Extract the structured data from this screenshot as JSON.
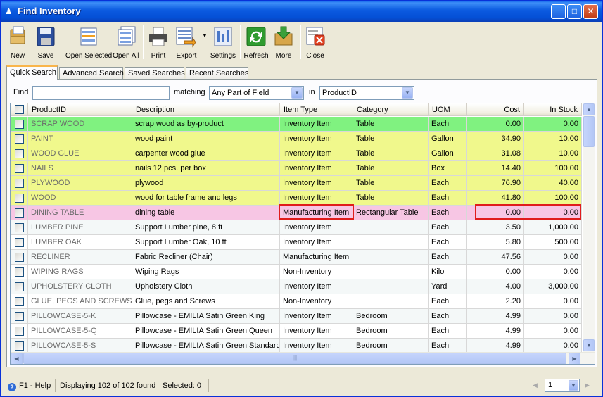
{
  "window": {
    "title": "Find Inventory",
    "controls": [
      "_",
      "□",
      "✕"
    ]
  },
  "toolbar": [
    {
      "label": "New",
      "icon": "new-icon"
    },
    {
      "label": "Save",
      "icon": "save-icon"
    },
    {
      "label": "Open Selected",
      "icon": "open-selected-icon"
    },
    {
      "label": "Open All",
      "icon": "open-all-icon"
    },
    {
      "label": "Print",
      "icon": "print-icon"
    },
    {
      "label": "Export",
      "icon": "export-icon"
    },
    {
      "label": "Settings",
      "icon": "settings-icon"
    },
    {
      "label": "Refresh",
      "icon": "refresh-icon"
    },
    {
      "label": "More",
      "icon": "more-icon"
    },
    {
      "label": "Close",
      "icon": "close-icon"
    }
  ],
  "tabs": [
    "Quick Search",
    "Advanced Search",
    "Saved Searches",
    "Recent Searches"
  ],
  "find": {
    "label": "Find",
    "value": "",
    "matching_label": "matching",
    "matching_value": "Any Part of Field",
    "in_label": "in",
    "in_value": "ProductID"
  },
  "columns": [
    "ProductID",
    "Description",
    "Item Type",
    "Category",
    "UOM",
    "Cost",
    "In Stock"
  ],
  "rows": [
    {
      "id": "SCRAP WOOD",
      "desc": "scrap wood as by-product",
      "type": "Inventory Item",
      "cat": "Table",
      "uom": "Each",
      "cost": "0.00",
      "stock": "0.00",
      "bg": "#80f280"
    },
    {
      "id": "PAINT",
      "desc": "wood paint",
      "type": "Inventory Item",
      "cat": "Table",
      "uom": "Gallon",
      "cost": "34.90",
      "stock": "10.00",
      "bg": "#f0f88c"
    },
    {
      "id": "WOOD GLUE",
      "desc": "carpenter wood glue",
      "type": "Inventory Item",
      "cat": "Table",
      "uom": "Gallon",
      "cost": "31.08",
      "stock": "10.00",
      "bg": "#f0f88c"
    },
    {
      "id": "NAILS",
      "desc": "nails 12 pcs. per box",
      "type": "Inventory Item",
      "cat": "Table",
      "uom": "Box",
      "cost": "14.40",
      "stock": "100.00",
      "bg": "#f0f88c"
    },
    {
      "id": "PLYWOOD",
      "desc": "plywood",
      "type": "Inventory Item",
      "cat": "Table",
      "uom": "Each",
      "cost": "76.90",
      "stock": "40.00",
      "bg": "#f0f88c"
    },
    {
      "id": "WOOD",
      "desc": "wood for table frame and legs",
      "type": "Inventory Item",
      "cat": "Table",
      "uom": "Each",
      "cost": "41.80",
      "stock": "100.00",
      "bg": "#f0f88c"
    },
    {
      "id": "DINING TABLE",
      "desc": "dining table",
      "type": "Manufacturing Item",
      "cat": "Rectangular Table",
      "uom": "Each",
      "cost": "0.00",
      "stock": "0.00",
      "bg": "#f7c6e4"
    },
    {
      "id": "LUMBER PINE",
      "desc": "Support Lumber pine, 8 ft",
      "type": "Inventory Item",
      "cat": "",
      "uom": "Each",
      "cost": "3.50",
      "stock": "1,000.00",
      "bg": "#f4f8f8"
    },
    {
      "id": "LUMBER OAK",
      "desc": "Support Lumber Oak, 10 ft",
      "type": "Inventory Item",
      "cat": "",
      "uom": "Each",
      "cost": "5.80",
      "stock": "500.00",
      "bg": "#ffffff"
    },
    {
      "id": "RECLINER",
      "desc": "Fabric Recliner (Chair)",
      "type": "Manufacturing Item",
      "cat": "",
      "uom": "Each",
      "cost": "47.56",
      "stock": "0.00",
      "bg": "#f4f8f8"
    },
    {
      "id": "WIPING RAGS",
      "desc": "Wiping Rags",
      "type": "Non-Inventory",
      "cat": "",
      "uom": "Kilo",
      "cost": "0.00",
      "stock": "0.00",
      "bg": "#ffffff"
    },
    {
      "id": "UPHOLSTERY CLOTH",
      "desc": "Upholstery Cloth",
      "type": "Inventory Item",
      "cat": "",
      "uom": "Yard",
      "cost": "4.00",
      "stock": "3,000.00",
      "bg": "#f4f8f8"
    },
    {
      "id": "GLUE, PEGS AND SCREWS",
      "desc": "Glue, pegs and Screws",
      "type": "Non-Inventory",
      "cat": "",
      "uom": "Each",
      "cost": "2.20",
      "stock": "0.00",
      "bg": "#ffffff"
    },
    {
      "id": "PILLOWCASE-5-K",
      "desc": "Pillowcase - EMILIA Satin Green King",
      "type": "Inventory Item",
      "cat": "Bedroom",
      "uom": "Each",
      "cost": "4.99",
      "stock": "0.00",
      "bg": "#f4f8f8"
    },
    {
      "id": "PILLOWCASE-5-Q",
      "desc": "Pillowcase - EMILIA Satin Green Queen",
      "type": "Inventory Item",
      "cat": "Bedroom",
      "uom": "Each",
      "cost": "4.99",
      "stock": "0.00",
      "bg": "#ffffff"
    },
    {
      "id": "PILLOWCASE-5-S",
      "desc": "Pillowcase - EMILIA Satin Green Standard",
      "type": "Inventory Item",
      "cat": "Bedroom",
      "uom": "Each",
      "cost": "4.99",
      "stock": "0.00",
      "bg": "#f4f8f8"
    }
  ],
  "status": {
    "help": "F1 - Help",
    "displaying": "Displaying 102 of 102 found",
    "selected": "Selected: 0",
    "page": "1"
  }
}
